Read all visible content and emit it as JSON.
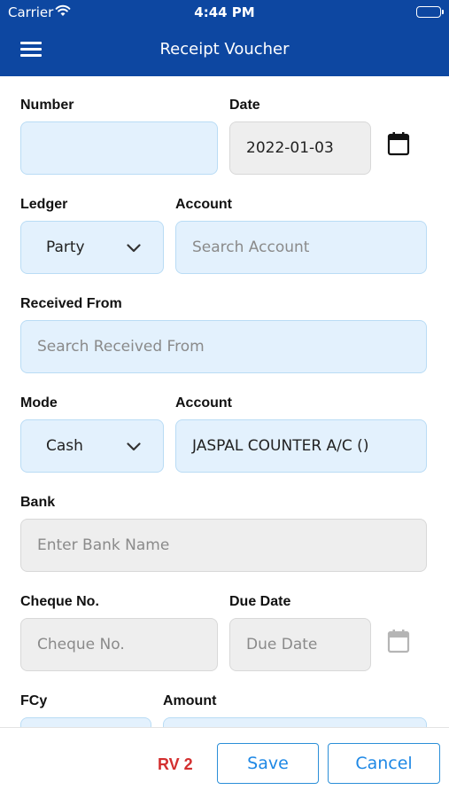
{
  "status_bar": {
    "carrier": "Carrier",
    "time": "4:44 PM"
  },
  "header": {
    "title": "Receipt Voucher"
  },
  "form": {
    "number": {
      "label": "Number",
      "value": ""
    },
    "date": {
      "label": "Date",
      "value": "2022-01-03"
    },
    "ledger": {
      "label": "Ledger",
      "value": "Party"
    },
    "account": {
      "label": "Account",
      "placeholder": "Search Account"
    },
    "received_from": {
      "label": "Received From",
      "placeholder": "Search Received From"
    },
    "mode": {
      "label": "Mode",
      "value": "Cash"
    },
    "mode_account": {
      "label": "Account",
      "value": "JASPAL COUNTER A/C ()"
    },
    "bank": {
      "label": "Bank",
      "placeholder": "Enter Bank Name"
    },
    "cheque_no": {
      "label": "Cheque No.",
      "placeholder": "Cheque No."
    },
    "due_date": {
      "label": "Due Date",
      "placeholder": "Due Date"
    },
    "fcy": {
      "label": "FCy"
    },
    "amount": {
      "label": "Amount"
    }
  },
  "footer": {
    "voucher_no": "RV 2",
    "save_label": "Save",
    "cancel_label": "Cancel"
  },
  "colors": {
    "header_bg": "#0d47a1",
    "field_blue": "#e3f1fd",
    "field_grey": "#eeeeee",
    "voucher_red": "#d32f2f",
    "button_blue": "#1e88e5"
  }
}
